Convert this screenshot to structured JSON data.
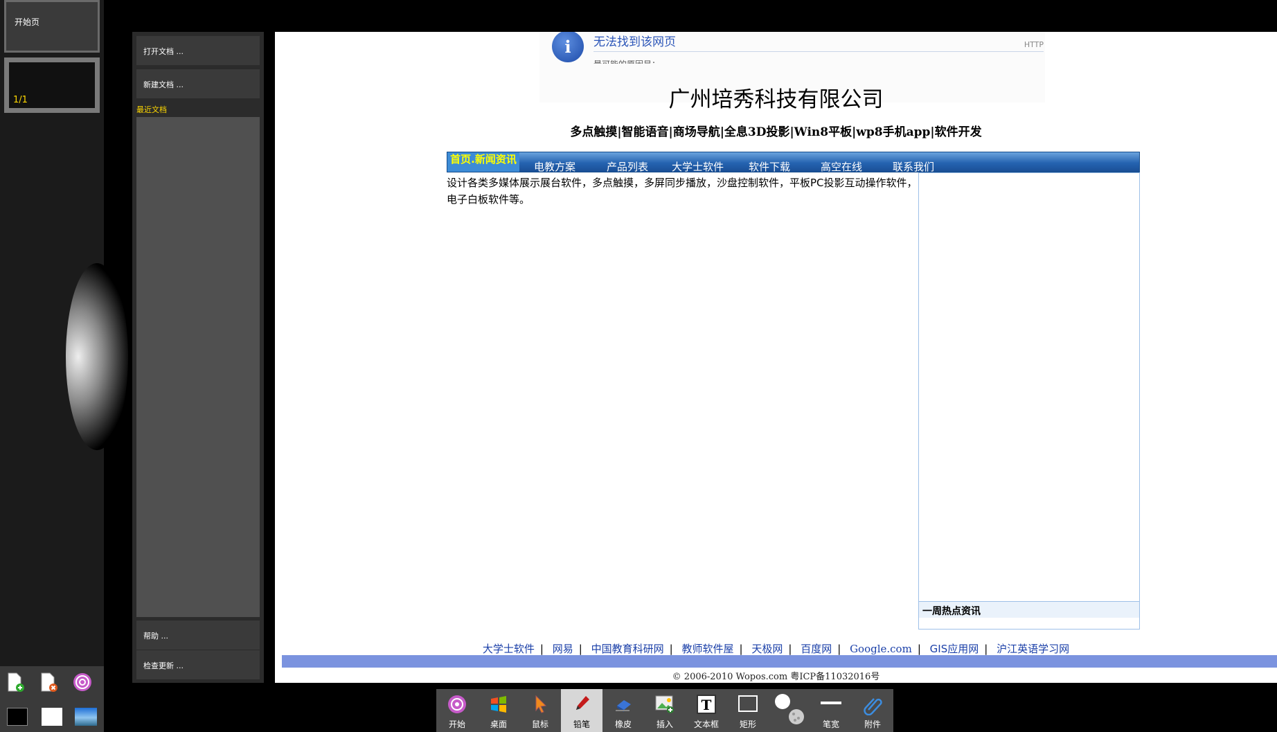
{
  "rail": {
    "start_tab": "开始页",
    "page_counter": "1/1"
  },
  "menu": {
    "open_doc": "打开文档 ...",
    "new_doc": "新建文档 ...",
    "recent_label": "最近文档",
    "help": "帮助 ...",
    "check_update": "检查更新 ..."
  },
  "browser": {
    "error_title": "无法找到该网页",
    "error_http": "HTTP",
    "error_cut": "最可能的原因是：",
    "company": "广州培秀科技有限公司",
    "tagline": "多点触摸|智能语音|商场导航|全息3D投影|Win8平板|wp8手机app|软件开发",
    "nav": {
      "home": "首页.新闻资讯",
      "items": [
        "电教方案",
        "产品列表",
        "大学士软件",
        "软件下载",
        "高空在线",
        "联系我们"
      ]
    },
    "intro": "设计各类多媒体展示展台软件，多点触摸，多屏同步播放，沙盘控制软件，平板PC投影互动操作软件，电子白板软件等。",
    "side_heading": "一周热点资讯",
    "links": [
      "大学士软件",
      "网易",
      "中国教育科研网",
      "教师软件屋",
      "天极网",
      "百度网",
      "Google.com",
      "GIS应用网",
      "沪江英语学习网"
    ],
    "copyright": "© 2006-2010 Wopos.com 粤ICP备11032016号"
  },
  "toolbar": {
    "items": [
      "开始",
      "桌面",
      "鼠标",
      "铅笔",
      "橡皮",
      "插入",
      "文本框",
      "矩形",
      "",
      "笔宽",
      "附件"
    ],
    "active": "铅笔"
  },
  "colors": {
    "accent_yellow": "#ffd800",
    "nav_blue": "#2563b0",
    "link_blue": "#1a3fa8"
  }
}
